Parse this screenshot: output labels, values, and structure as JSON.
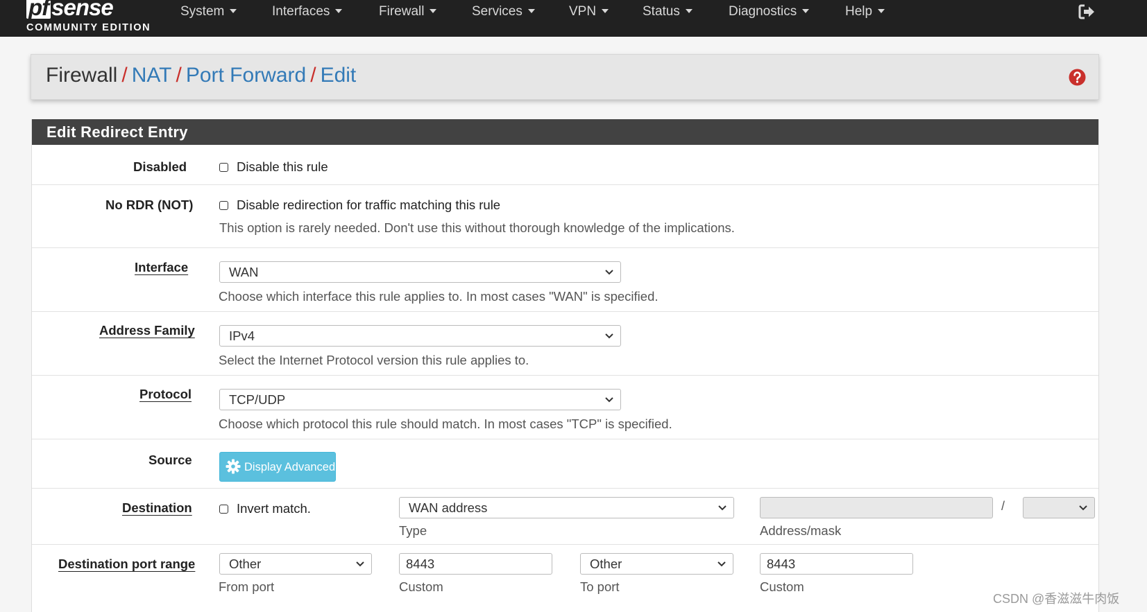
{
  "navbar": {
    "logo_text": "sense",
    "logo_pf": "pf",
    "logo_edition": "COMMUNITY EDITION",
    "menu": [
      {
        "label": "System"
      },
      {
        "label": "Interfaces"
      },
      {
        "label": "Firewall"
      },
      {
        "label": "Services"
      },
      {
        "label": "VPN"
      },
      {
        "label": "Status"
      },
      {
        "label": "Diagnostics"
      },
      {
        "label": "Help"
      }
    ],
    "logout_icon": "sign-out-icon"
  },
  "breadcrumb": {
    "root": "Firewall",
    "items": [
      "NAT",
      "Port Forward",
      "Edit"
    ],
    "separator": "/",
    "help_icon": "question-circle-icon"
  },
  "panel": {
    "title": "Edit Redirect Entry"
  },
  "form": {
    "disabled": {
      "label": "Disabled",
      "checkbox_label": "Disable this rule",
      "checked": false
    },
    "nordr": {
      "label": "No RDR (NOT)",
      "checkbox_label": "Disable redirection for traffic matching this rule",
      "help": "This option is rarely needed. Don't use this without thorough knowledge of the implications.",
      "checked": false
    },
    "interface": {
      "label": "Interface",
      "value": "WAN",
      "help": "Choose which interface this rule applies to. In most cases \"WAN\" is specified."
    },
    "address_family": {
      "label": "Address Family",
      "value": "IPv4",
      "help": "Select the Internet Protocol version this rule applies to."
    },
    "protocol": {
      "label": "Protocol",
      "value": "TCP/UDP",
      "help": "Choose which protocol this rule should match. In most cases \"TCP\" is specified."
    },
    "source": {
      "label": "Source",
      "button_label": "Display Advanced",
      "button_icon": "gear-icon"
    },
    "destination": {
      "label": "Destination",
      "invert_label": "Invert match.",
      "invert_checked": false,
      "type_value": "WAN address",
      "type_caption": "Type",
      "address_value": "",
      "mask_separator": "/",
      "mask_value": "",
      "address_caption": "Address/mask"
    },
    "dest_port_range": {
      "label": "Destination port range",
      "from_value": "Other",
      "from_caption": "From port",
      "from_custom": "8443",
      "from_custom_caption": "Custom",
      "to_value": "Other",
      "to_caption": "To port",
      "to_custom": "8443",
      "to_custom_caption": "Custom"
    }
  },
  "colors": {
    "navbar_bg": "#212121",
    "panel_head_bg": "#424242",
    "link": "#337ab7",
    "separator": "#c9302c",
    "help_icon": "#c9302c",
    "info_button": "#5bc0de"
  },
  "watermark": "CSDN @香滋滋牛肉饭"
}
